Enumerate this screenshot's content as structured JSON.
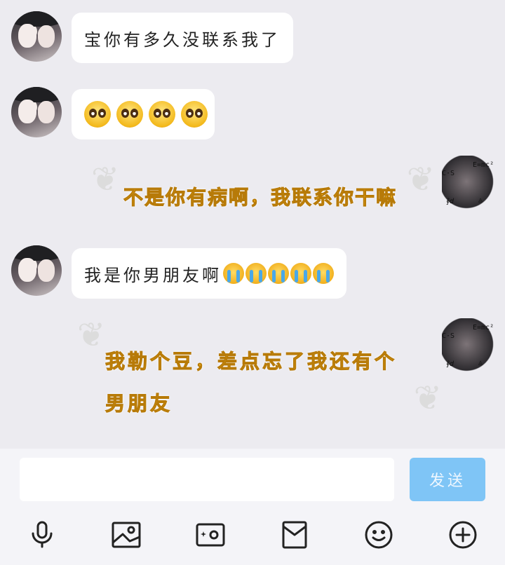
{
  "messages": [
    {
      "side": "left",
      "text": "宝你有多久没联系我了"
    },
    {
      "side": "left",
      "emoji": "pleading-face x4"
    },
    {
      "side": "right",
      "styled_text": "不是你有病啊，我联系你干嘛"
    },
    {
      "side": "left",
      "text": "我是你男朋友啊",
      "emoji": "crying-face x5"
    },
    {
      "side": "right",
      "styled_text": "我勒个豆，差点忘了我还有个男朋友"
    }
  ],
  "composer": {
    "input_placeholder": "",
    "send_label": "发送"
  },
  "toolbar": [
    "mic-icon",
    "image-icon",
    "camera-icon",
    "red-packet-icon",
    "emoji-icon",
    "plus-icon"
  ],
  "colors": {
    "background": "#ecebf0",
    "bubble": "#ffffff",
    "send": "#7fc5f6",
    "gold_text": "#f3b21b"
  }
}
